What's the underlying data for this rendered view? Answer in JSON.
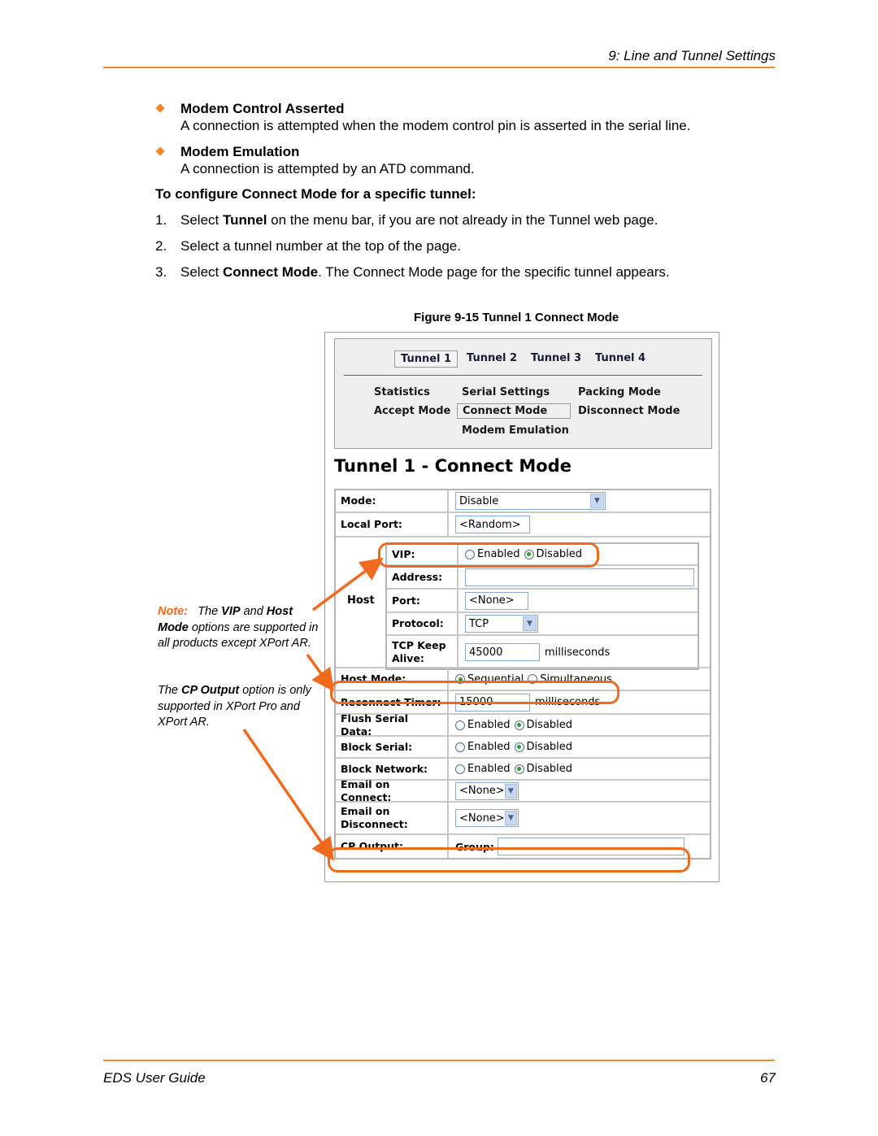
{
  "header": {
    "chapter_title": "9: Line and Tunnel Settings"
  },
  "bullets": [
    {
      "title": "Modem Control Asserted",
      "description": "A connection is attempted when the modem control pin is asserted in the serial line."
    },
    {
      "title": "Modem Emulation",
      "description": "A connection is attempted by an ATD command."
    }
  ],
  "procedure": {
    "heading": "To configure Connect Mode for a specific tunnel:",
    "steps": [
      {
        "num": "1.",
        "pre": "Select ",
        "bold": "Tunnel",
        "post": " on the menu bar, if you are not already in the Tunnel web page."
      },
      {
        "num": "2.",
        "pre": "Select a tunnel number at the top of the page.",
        "bold": "",
        "post": ""
      },
      {
        "num": "3.",
        "pre": "Select ",
        "bold": "Connect Mode",
        "post": ".  The Connect Mode page for the specific tunnel appears."
      }
    ]
  },
  "figure": {
    "caption": "Figure 9-15  Tunnel 1 Connect Mode",
    "tunnel_tabs": [
      "Tunnel 1",
      "Tunnel 2",
      "Tunnel 3",
      "Tunnel 4"
    ],
    "active_tunnel": "Tunnel 1",
    "nav_links": [
      "Statistics",
      "Serial Settings",
      "Packing Mode",
      "Accept Mode",
      "Connect Mode",
      "Disconnect Mode",
      "Modem Emulation"
    ],
    "active_link": "Connect Mode",
    "page_title": "Tunnel 1 - Connect Mode",
    "form": {
      "mode": {
        "label": "Mode:",
        "value": "Disable"
      },
      "local_port": {
        "label": "Local Port:",
        "value": "<Random>"
      },
      "host": {
        "label": "Host",
        "vip": {
          "label": "VIP:",
          "options": [
            "Enabled",
            "Disabled"
          ],
          "selected": "Disabled"
        },
        "address": {
          "label": "Address:",
          "value": ""
        },
        "port": {
          "label": "Port:",
          "value": "<None>"
        },
        "protocol": {
          "label": "Protocol:",
          "value": "TCP"
        },
        "tcp_keep_alive": {
          "label_line1": "TCP Keep",
          "label_line2": "Alive:",
          "value": "45000",
          "unit": "milliseconds"
        }
      },
      "host_mode": {
        "label": "Host Mode:",
        "options": [
          "Sequential",
          "Simultaneous"
        ],
        "selected": "Sequential"
      },
      "reconnect_timer": {
        "label": "Reconnect Timer:",
        "value": "15000",
        "unit": "milliseconds"
      },
      "flush_serial_data": {
        "label": "Flush Serial Data:",
        "options": [
          "Enabled",
          "Disabled"
        ],
        "selected": "Disabled"
      },
      "block_serial": {
        "label": "Block Serial:",
        "options": [
          "Enabled",
          "Disabled"
        ],
        "selected": "Disabled"
      },
      "block_network": {
        "label": "Block Network:",
        "options": [
          "Enabled",
          "Disabled"
        ],
        "selected": "Disabled"
      },
      "email_on_connect": {
        "label": "Email on Connect:",
        "value": "<None>"
      },
      "email_on_disconnect": {
        "label_line1": "Email on",
        "label_line2": "Disconnect:",
        "value": "<None>"
      },
      "cp_output": {
        "label": "CP Output:",
        "group_label": "Group:",
        "group_value": ""
      }
    }
  },
  "notes": {
    "note_label": "Note:",
    "note1_pre": "The ",
    "note1_b1": "VIP",
    "note1_mid": " and ",
    "note1_b2": "Host Mode",
    "note1_post": " options are supported in all products except XPort AR.",
    "note2_pre": "The ",
    "note2_b": "CP Output",
    "note2_post": " option is only supported in XPort Pro and XPort AR."
  },
  "footer": {
    "guide_title": "EDS User Guide",
    "page_number": "67"
  },
  "colors": {
    "accent": "#f08a2c",
    "highlight": "#f06a1e",
    "radio_checked": "#2aa02a"
  }
}
